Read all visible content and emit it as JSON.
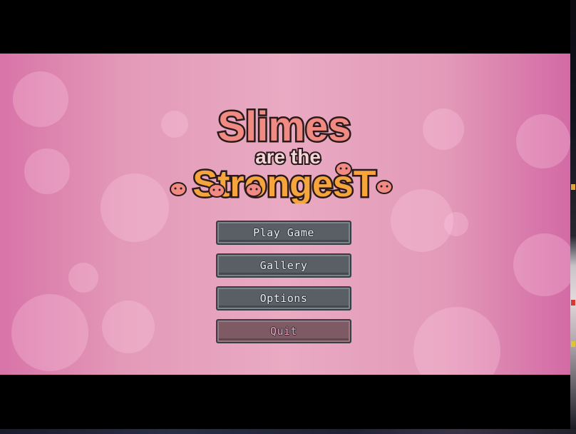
{
  "game": {
    "title_line1": "Slimes",
    "title_line2": "are the",
    "title_line3": "StrongesT"
  },
  "menu": {
    "play_label": "Play Game",
    "gallery_label": "Gallery",
    "options_label": "Options",
    "quit_label": "Quit"
  },
  "colors": {
    "background_pink": "#e9aac2",
    "title_salmon": "#ec7f7a",
    "title_orange": "#f4a23a",
    "button_gray": "#5a5f66",
    "button_quit": "#7d5a64",
    "quit_text": "#e8a1b8"
  }
}
